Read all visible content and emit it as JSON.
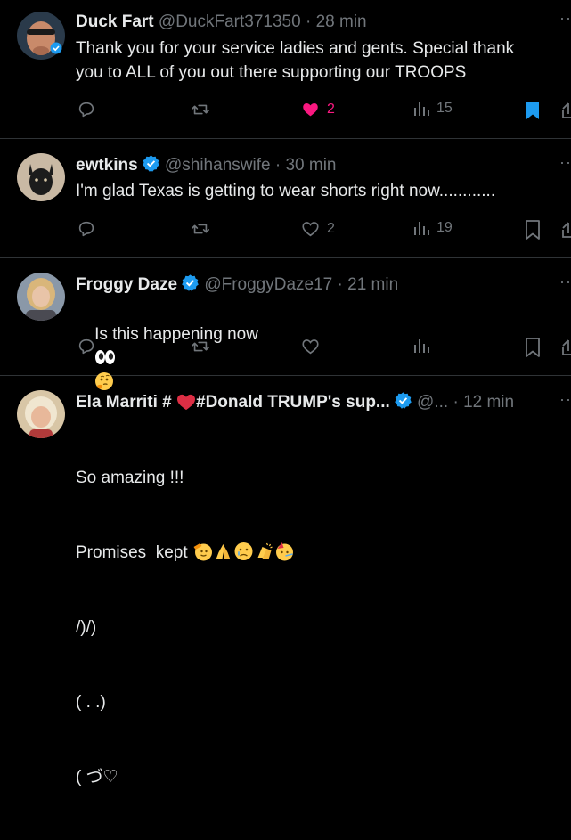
{
  "posts": [
    {
      "name": "Duck Fart",
      "handle": "@DuckFart371350",
      "time": "28 min",
      "text": "Thank you for your service ladies and gents. Special thank\nyou to ALL of you out there supporting our TROOPS",
      "likes": "2",
      "views": "15",
      "liked": true,
      "bookmarked": true
    },
    {
      "name": "ewtkins",
      "handle": "@shihanswife",
      "time": "30 min",
      "text": "I'm glad Texas is getting to wear shorts right now............",
      "likes": "2",
      "views": "19",
      "liked": false,
      "bookmarked": false
    },
    {
      "name": "Froggy Daze",
      "handle": "@FroggyDaze17",
      "time": "21 min",
      "text": "Is this happening now",
      "likes": "",
      "views": "",
      "liked": false,
      "bookmarked": false
    },
    {
      "name_prefix": "Ela Marriti #",
      "name_suffix": "#Donald TRUMP's sup...",
      "handle": "@...",
      "time": "12 min",
      "lines": [
        "So amazing !!!",
        "Promises  kept",
        "/)/)",
        "( . .)",
        "( づ♡"
      ]
    }
  ],
  "separator": "·",
  "colors": {
    "accent": "#1d9bf0",
    "like": "#f91880",
    "muted": "#71767b",
    "text": "#e7e9ea",
    "border": "#2f3336"
  }
}
